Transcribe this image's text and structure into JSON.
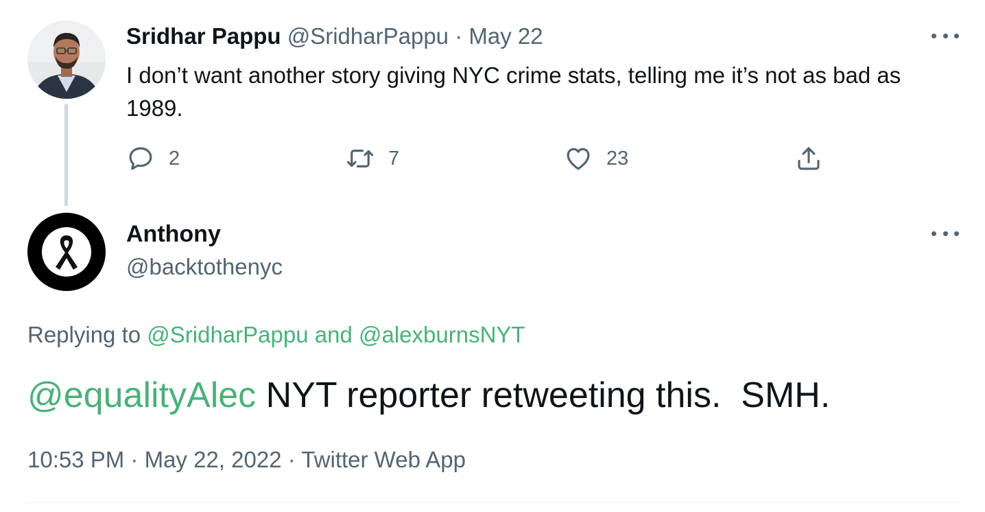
{
  "parent_tweet": {
    "author_name": "Sridhar Pappu",
    "author_handle": "@SridharPappu",
    "separator": "·",
    "date": "May 22",
    "text": "I don’t want another story giving NYC crime stats, telling me it’s not as bad as 1989.",
    "reply_count": "2",
    "retweet_count": "7",
    "like_count": "23"
  },
  "reply_tweet": {
    "author_name": "Anthony",
    "author_handle": "@backtothenyc",
    "replying_prefix": "Replying to",
    "replying_user_1": "@SridharPappu",
    "replying_and": "and",
    "replying_user_2": "@alexburnsNYT",
    "mention": "@equalityAlec",
    "text": " NYT reporter retweeting this.  SMH.",
    "time": "10:53 PM",
    "separator": "·",
    "date": "May 22, 2022",
    "source": "Twitter Web App"
  },
  "icons": {
    "more": "more-horizontal-icon",
    "reply": "speech-bubble-icon",
    "retweet": "retweet-arrows-icon",
    "like": "heart-icon",
    "share": "share-upload-icon",
    "avatar2": "black-ribbon-icon"
  },
  "colors": {
    "text_primary": "#0f1419",
    "text_secondary": "#536471",
    "link": "#4bb07a",
    "thread_line": "#cfd9de"
  }
}
